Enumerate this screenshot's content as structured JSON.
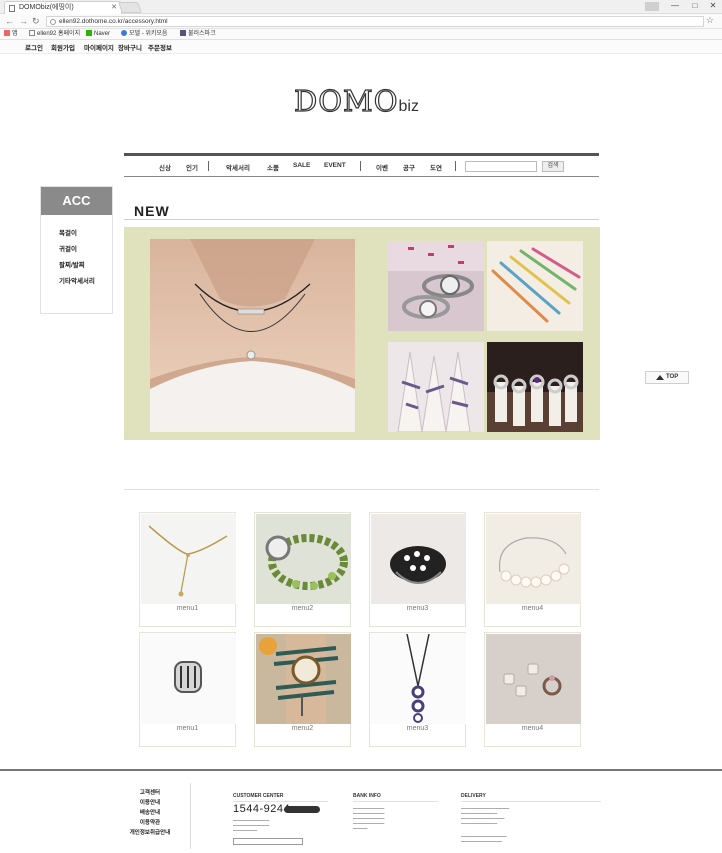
{
  "browser": {
    "tab_title": "DOMObiz(에띵이)",
    "url": "ellen92.dothome.co.kr/accessory.html",
    "bookmarks": [
      "앱",
      "ellen92 홈페이지",
      "Naver",
      "모델 - 위키모음",
      "불러스파크"
    ]
  },
  "top_links": [
    "로그인",
    "회원가입",
    "마이페이지",
    "장바구니",
    "주문정보"
  ],
  "logo": {
    "main": "DOMO",
    "suffix": "biz"
  },
  "gnb": {
    "items": [
      "신상",
      "인기",
      "악세서리",
      "소품",
      "SALE",
      "EVENT",
      "이벤",
      "공구",
      "도연"
    ],
    "search_button": "검색"
  },
  "side": {
    "title": "ACC",
    "items": [
      "목걸이",
      "귀걸이",
      "팔찌/발찌",
      "기타악세서리"
    ]
  },
  "section_title": "NEW",
  "feature_photos": [
    "necklace-photo",
    "watch-photo",
    "friendship-bracelets-photo",
    "bracelets-cones-photo",
    "rings-display-photo"
  ],
  "products": [
    {
      "label": "menu1",
      "kind": "necklace"
    },
    {
      "label": "menu2",
      "kind": "green-watch"
    },
    {
      "label": "menu3",
      "kind": "black-ring"
    },
    {
      "label": "menu4",
      "kind": "pearl-bracelet"
    },
    {
      "label": "menu1",
      "kind": "silver-ring"
    },
    {
      "label": "menu2",
      "kind": "wrap-watch"
    },
    {
      "label": "menu3",
      "kind": "pendant-necklace"
    },
    {
      "label": "menu4",
      "kind": "earrings"
    }
  ],
  "top_button": "TOP",
  "footer": {
    "links": [
      "고객센터",
      "이용안내",
      "배송안내",
      "이용약관",
      "개인정보취급안내"
    ],
    "customer_center": "CUSTOMER CENTER",
    "phone": "1544-9244",
    "bank_info": "BANK INFO",
    "delivery": "DELIVERY"
  },
  "colors": {
    "feature_bg": "#e0e1bd",
    "side_header": "#8a8a8a",
    "nav_border": "#555555"
  }
}
